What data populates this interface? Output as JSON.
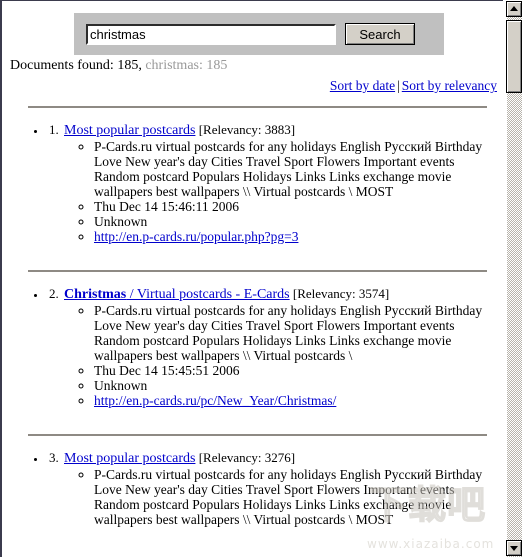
{
  "search": {
    "query_value": "christmas",
    "placeholder": "",
    "button_label": "Search"
  },
  "status": {
    "found_label": "Documents found: 185,",
    "term_count": "christmas: 185"
  },
  "sort": {
    "by_date": "Sort by date",
    "separator": "|",
    "by_relevancy": "Sort by relevancy"
  },
  "results": [
    {
      "number": "1.",
      "title_hit": "",
      "title": "Most popular postcards",
      "relevancy": "[Relevancy: 3883]",
      "snippet": "P-Cards.ru virtual postcards for any holidays English Русский Birthday Love New year's day Cities Travel Sport Flowers Important events Random postcard Populars Holidays Links Links exchange movie wallpapers best wallpapers \\\\ Virtual postcards \\ MOST",
      "date": "Thu Dec 14 15:46:11 2006",
      "author": "Unknown",
      "url": "http://en.p-cards.ru/popular.php?pg=3"
    },
    {
      "number": "2.",
      "title_hit": "Christmas",
      "title": " / Virtual postcards - E-Cards",
      "relevancy": "[Relevancy: 3574]",
      "snippet": "P-Cards.ru virtual postcards for any holidays English Русский Birthday Love New year's day Cities Travel Sport Flowers Important events Random postcard Populars Holidays Links Links exchange movie wallpapers best wallpapers \\\\ Virtual postcards \\",
      "date": "Thu Dec 14 15:45:51 2006",
      "author": "Unknown",
      "url": "http://en.p-cards.ru/pc/New_Year/Christmas/"
    },
    {
      "number": "3.",
      "title_hit": "",
      "title": "Most popular postcards",
      "relevancy": "[Relevancy: 3276]",
      "snippet": "P-Cards.ru virtual postcards for any holidays English Русский Birthday Love New year's day Cities Travel Sport Flowers Important events Random postcard Populars Holidays Links Links exchange movie wallpapers best wallpapers \\\\ Virtual postcards \\ MOST",
      "date": "",
      "author": "",
      "url": ""
    }
  ],
  "watermark": {
    "logo": "下载吧",
    "url": "www.xiazaiba.com"
  },
  "scrollbar": {
    "up_arrow": "scroll-up-arrow-icon",
    "down_arrow": "scroll-down-arrow-icon"
  },
  "colors": {
    "link": "#0000cc",
    "panel": "#c0c0c0",
    "button_face": "#d4d0c8",
    "rule": "#8e8a84",
    "dim_text": "#999999"
  }
}
